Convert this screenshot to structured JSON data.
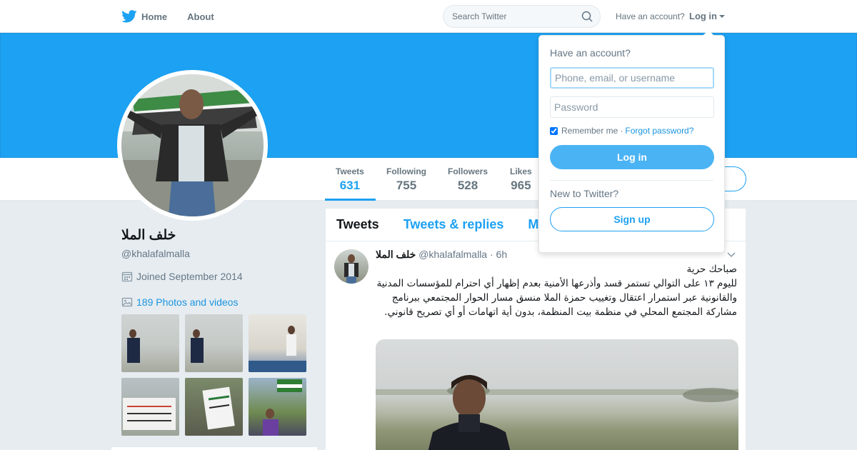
{
  "nav": {
    "home_label": "Home",
    "about_label": "About",
    "search_placeholder": "Search Twitter",
    "have_account": "Have an account?",
    "login_label": "Log in"
  },
  "profile": {
    "name": "خلف الملا",
    "handle": "@khalafalmalla",
    "joined": "Joined September 2014",
    "photos_videos": "189 Photos and videos"
  },
  "stats": [
    {
      "label": "Tweets",
      "value": "631"
    },
    {
      "label": "Following",
      "value": "755"
    },
    {
      "label": "Followers",
      "value": "528"
    },
    {
      "label": "Likes",
      "value": "965"
    }
  ],
  "timeline": {
    "tabs": [
      "Tweets",
      "Tweets & replies",
      "M"
    ]
  },
  "tweet": {
    "name": "خلف الملا",
    "handle": "@khalafalmalla",
    "time": "· 6h",
    "text": "صباحك حرية\nلليوم ١٣ على التوالي تستمر قسد وأذرعها الأمنية بعدم إظهار أي احترام للمؤسسات المدنية والقانونية عبر استمرار اعتقال وتغييب حمزة الملا منسق مسار الحوار المجتمعي ببرنامج مشاركة المجتمع المحلي في منظمة بيت المنظمة، بدون أية اتهامات أو أي تصريح قانوني."
  },
  "login_dropdown": {
    "title": "Have an account?",
    "username_placeholder": "Phone, email, or username",
    "password_placeholder": "Password",
    "remember_me": "Remember me",
    "forgot_password": "Forgot password?",
    "login_button": "Log in",
    "new_to_twitter": "New to Twitter?",
    "signup_button": "Sign up"
  },
  "colors": {
    "brand": "#1da1f2",
    "banner": "#1da1f2",
    "login_button": "#4ab3f4",
    "page_background": "#e6ecf0"
  },
  "icons": {
    "logo": "twitter-bird-icon",
    "search": "search-icon",
    "calendar": "calendar-icon",
    "photo": "photo-icon",
    "caret": "caret-down-icon",
    "chevron": "chevron-down-icon"
  }
}
